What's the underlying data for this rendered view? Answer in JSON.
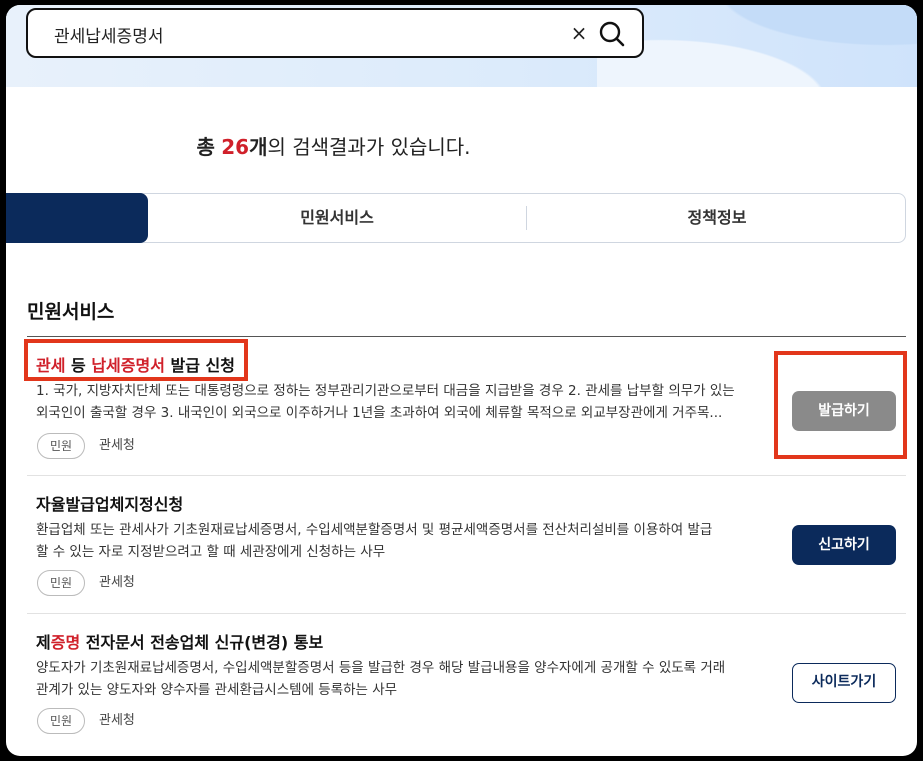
{
  "search": {
    "value": "관세납세증명서",
    "clear_glyph": "×"
  },
  "summary": {
    "prefix": "총",
    "count": "26",
    "unit": "개",
    "suffix": "의 검색결과가 있습니다."
  },
  "tabs": [
    {
      "label": "",
      "active": true
    },
    {
      "label": "민원서비스",
      "active": false
    },
    {
      "label": "정책정보",
      "active": false
    }
  ],
  "section": {
    "title": "민원서비스"
  },
  "results": [
    {
      "title_parts": [
        {
          "text": "관세",
          "hl": true
        },
        {
          "text": " 등 ",
          "hl": false
        },
        {
          "text": "납세증명서",
          "hl": true
        },
        {
          "text": " 발급 신청",
          "hl": false
        }
      ],
      "desc_lines": [
        "1. 국가, 지방자치단체 또는 대통령령으로 정하는 정부관리기관으로부터 대금을 지급받을 경우 2. 관세를 납부할 의무가 있는",
        "외국인이 출국할 경우 3. 내국인이 외국으로 이주하거나 1년을 초과하여 외국에 체류할 목적으로 외교부장관에게 거주목..."
      ],
      "badge": "민원",
      "org": "관세청",
      "button": "발급하기"
    },
    {
      "title_parts": [
        {
          "text": "자율발급업체지정신청",
          "hl": false
        }
      ],
      "desc_lines": [
        "환급업체 또는 관세사가 기초원재료납세증명서, 수입세액분할증명서 및 평균세액증명서를 전산처리설비를 이용하여 발급",
        "할 수 있는 자로 지정받으려고 할 때 세관장에게 신청하는 사무"
      ],
      "badge": "민원",
      "org": "관세청",
      "button": "신고하기"
    },
    {
      "title_parts": [
        {
          "text": "제",
          "hl": false
        },
        {
          "text": "증명",
          "hl": true
        },
        {
          "text": " 전자문서 전송업체 신규(변경) 통보",
          "hl": false
        }
      ],
      "desc_lines": [
        "양도자가 기초원재료납세증명서, 수입세액분할증명서 등을 발급한 경우 해당 발급내용을 양수자에게 공개할 수 있도록 거래",
        "관계가 있는 양도자와 양수자를 관세환급시스템에 등록하는 사무"
      ],
      "badge": "민원",
      "org": "관세청",
      "button": "사이트가기"
    }
  ],
  "colors": {
    "accent_red": "#d0202a",
    "navy": "#0b2a5b",
    "annotation": "#e2361b"
  }
}
